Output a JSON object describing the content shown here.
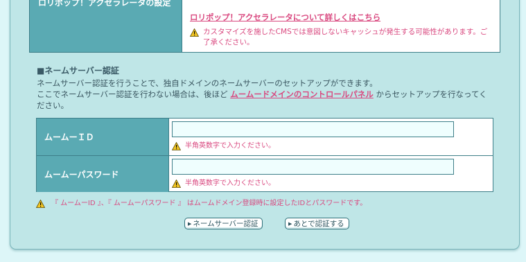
{
  "top_row": {
    "header": "ロリポップ！アクセラレータの設定",
    "link_text": "ロリポップ！アクセラレータについて詳しくはこちら",
    "warning": "カスタマイズを施したCMSでは意図しないキャッシュが発生する可能性があります。ご了承ください。"
  },
  "section": {
    "title": "■ネームサーバー認証",
    "desc_line1": "ネームサーバー認証を行うことで、独自ドメインのネームサーバーのセットアップができます。",
    "desc_line2_pre": "ここでネームサーバー認証を行わない場合は、後ほど ",
    "desc_link": "ムームードメインのコントロールパネル",
    "desc_line2_post": " からセットアップを行なってください。"
  },
  "form": {
    "id_label": "ムームーＩＤ",
    "id_value": "",
    "id_hint": "半角英数字で入力ください。",
    "pw_label": "ムームーパスワード",
    "pw_value": "",
    "pw_hint": "半角英数字で入力ください。"
  },
  "note": "『 ムームーID 』、『 ムームーパスワード 』 はムームドメイン登録時に設定したIDとパスワードです。",
  "buttons": {
    "auth": "ネームサーバー認証",
    "later": "あとで認証する"
  },
  "colors": {
    "accent_pink": "#d9487f",
    "header_teal": "#5aaab3",
    "panel_bg": "#bfe6e7",
    "page_bg": "#ddf6f8"
  },
  "icons": {
    "warning": "warning-triangle-icon",
    "button_arrow": "triangle-right-icon"
  }
}
